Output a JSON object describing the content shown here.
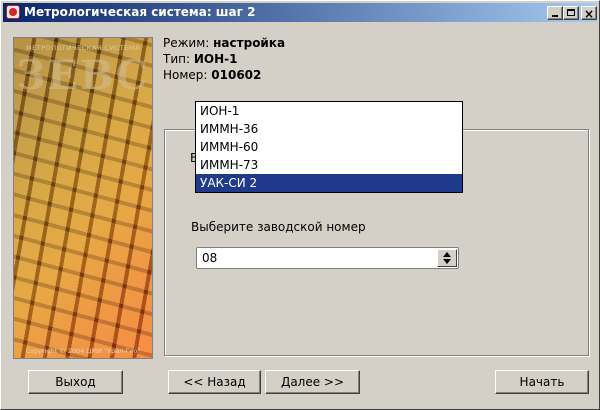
{
  "window": {
    "title": "Метрологическая система: шаг 2",
    "controls": {
      "minimize": "",
      "maximize": "",
      "close": "×"
    }
  },
  "banner": {
    "caption": "МЕТРОЛОГИЧЕСКАЯ СИСТЕМА",
    "logo": "ЗЕВС",
    "copyright": "Copyright © 2004 ЦМИ \"Урал-Гео\""
  },
  "info": {
    "mode_label": "Режим: ",
    "mode_value": "настройка",
    "type_label": "Тип: ",
    "type_value": "ИОН-1",
    "number_label": "Номер: ",
    "number_value": "010602"
  },
  "form": {
    "partial_label": "В",
    "serial_label": "Выберите заводской номер",
    "serial_value": "08"
  },
  "dropdown": {
    "options": [
      "ИОН-1",
      "ИММН-36",
      "ИММН-60",
      "ИММН-73",
      "УАК-СИ 2"
    ],
    "selected_index": 4
  },
  "buttons": {
    "exit": "Выход",
    "back": "<< Назад",
    "next": "Далее >>",
    "start": "Начать"
  }
}
